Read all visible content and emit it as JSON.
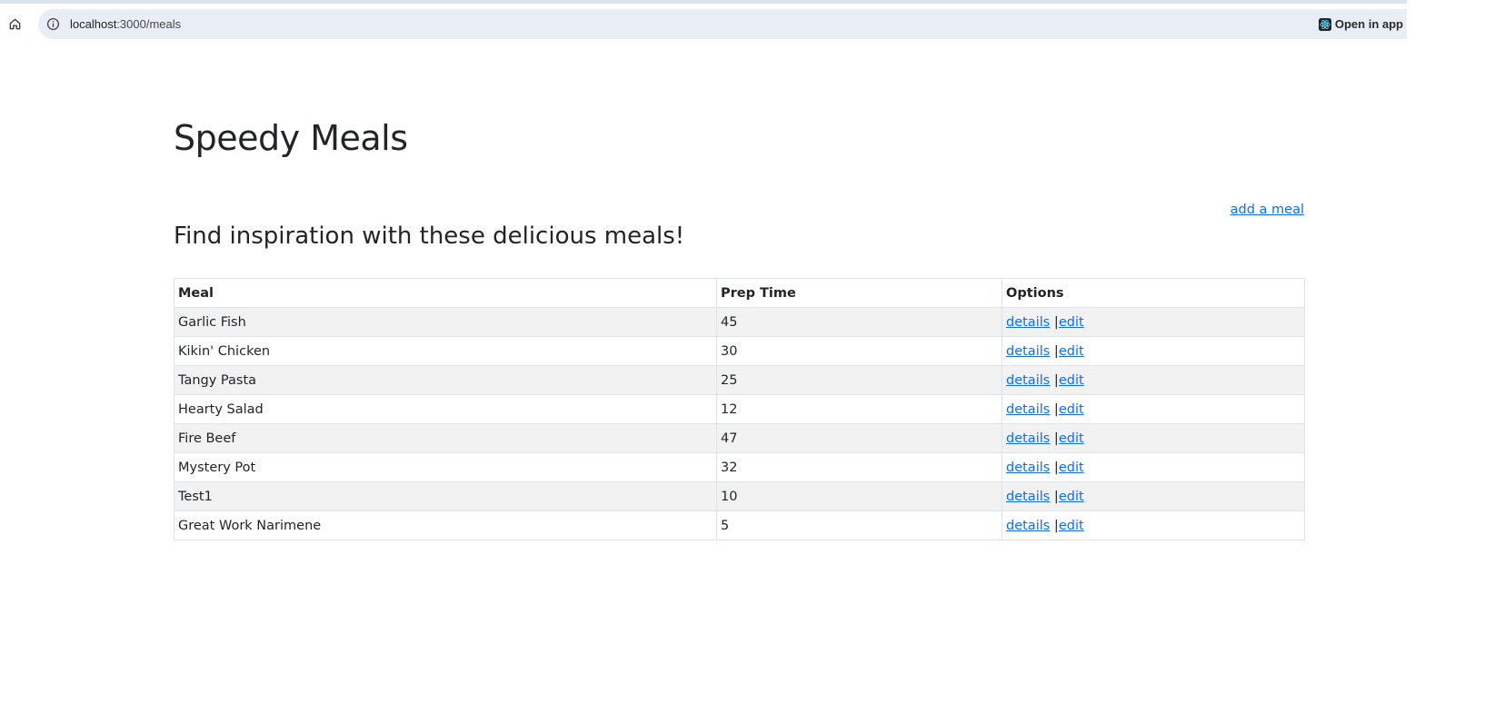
{
  "browser": {
    "url_host": "localhost",
    "url_path": ":3000/meals",
    "open_in_app_label": "Open in app"
  },
  "page": {
    "title": "Speedy Meals",
    "add_link": "add a meal",
    "subtitle": "Find inspiration with these delicious meals!"
  },
  "table": {
    "headers": [
      "Meal",
      "Prep Time",
      "Options"
    ],
    "rows": [
      {
        "meal": "Garlic Fish",
        "prep": "45",
        "details": "details",
        "sep": "|",
        "edit": "edit"
      },
      {
        "meal": "Kikin' Chicken",
        "prep": "30",
        "details": "details",
        "sep": "|",
        "edit": "edit"
      },
      {
        "meal": "Tangy Pasta",
        "prep": "25",
        "details": "details",
        "sep": "|",
        "edit": "edit"
      },
      {
        "meal": "Hearty Salad",
        "prep": "12",
        "details": "details",
        "sep": "|",
        "edit": "edit"
      },
      {
        "meal": "Fire Beef",
        "prep": "47",
        "details": "details",
        "sep": "|",
        "edit": "edit"
      },
      {
        "meal": "Mystery Pot",
        "prep": "32",
        "details": "details",
        "sep": "|",
        "edit": "edit"
      },
      {
        "meal": "Test1",
        "prep": "10",
        "details": "details",
        "sep": "|",
        "edit": "edit"
      },
      {
        "meal": "Great Work Narimene",
        "prep": "5",
        "details": "details",
        "sep": "|",
        "edit": "edit"
      }
    ]
  },
  "icons": {
    "home": "home-icon",
    "info": "info-icon",
    "app": "react-icon"
  },
  "colors": {
    "link": "#0d6efd",
    "text": "#212529",
    "stripe": "#f2f2f2",
    "address_bar": "#e9eef6"
  }
}
